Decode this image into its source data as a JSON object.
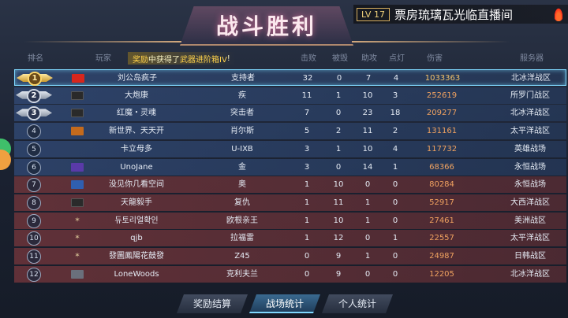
{
  "title": "战斗胜利",
  "broadcast": {
    "level": "LV 17",
    "text": "票房琉璃瓦光临直播间"
  },
  "notice": {
    "prefix": "奖励",
    "middle": "中获得了",
    "item": "武器进阶箱IV",
    "suffix": "!"
  },
  "headers": {
    "rank": "排名",
    "player": "玩家",
    "kills": "击败",
    "deaths": "被毁",
    "assists": "助攻",
    "points": "点灯",
    "damage": "伤害",
    "server": "服务器"
  },
  "rows": [
    {
      "rank": "1",
      "name": "刘公岛疯子",
      "ship": "支持者",
      "kills": "32",
      "deaths": "0",
      "assists": "7",
      "points": "4",
      "damage": "1033363",
      "server": "北冰洋战区",
      "team": "blue",
      "flag": "cn"
    },
    {
      "rank": "2",
      "name": "大炮康",
      "ship": "疾",
      "kills": "11",
      "deaths": "1",
      "assists": "10",
      "points": "3",
      "damage": "252619",
      "server": "所罗门战区",
      "team": "blue",
      "flag": "dark"
    },
    {
      "rank": "3",
      "name": "红魔・灵魂",
      "ship": "突击者",
      "kills": "7",
      "deaths": "0",
      "assists": "23",
      "points": "18",
      "damage": "209277",
      "server": "北冰洋战区",
      "team": "blue",
      "flag": "dark"
    },
    {
      "rank": "4",
      "name": "新世界、天天开",
      "ship": "肖尔斯",
      "kills": "5",
      "deaths": "2",
      "assists": "11",
      "points": "2",
      "damage": "131161",
      "server": "太平洋战区",
      "team": "blue",
      "flag": "orange"
    },
    {
      "rank": "5",
      "name": "卡立母多",
      "ship": "U-IXB",
      "kills": "3",
      "deaths": "1",
      "assists": "10",
      "points": "4",
      "damage": "117732",
      "server": "英雄战场",
      "team": "blue",
      "flag": "none"
    },
    {
      "rank": "6",
      "name": "UnoJane",
      "ship": "金",
      "kills": "3",
      "deaths": "0",
      "assists": "14",
      "points": "1",
      "damage": "68366",
      "server": "永恒战场",
      "team": "blue",
      "flag": "purple"
    },
    {
      "rank": "7",
      "name": "没见你几看空间",
      "ship": "奥",
      "kills": "1",
      "deaths": "10",
      "assists": "0",
      "points": "0",
      "damage": "80284",
      "server": "永恒战场",
      "team": "red",
      "flag": "blue"
    },
    {
      "rank": "8",
      "name": "天龍毅手",
      "ship": "复仇",
      "kills": "1",
      "deaths": "11",
      "assists": "1",
      "points": "0",
      "damage": "52917",
      "server": "大西洋战区",
      "team": "red",
      "flag": "dark"
    },
    {
      "rank": "9",
      "name": "듀토리얼확인",
      "ship": "欧根亲王",
      "kills": "1",
      "deaths": "10",
      "assists": "1",
      "points": "0",
      "damage": "27461",
      "server": "美洲战区",
      "team": "red",
      "flag": "star"
    },
    {
      "rank": "10",
      "name": "qjb",
      "ship": "拉福雷",
      "kills": "1",
      "deaths": "12",
      "assists": "0",
      "points": "1",
      "damage": "22557",
      "server": "太平洋战区",
      "team": "red",
      "flag": "star"
    },
    {
      "rank": "11",
      "name": "發圖鳳陽花鼓發",
      "ship": "Z45",
      "kills": "0",
      "deaths": "9",
      "assists": "1",
      "points": "0",
      "damage": "24987",
      "server": "日韩战区",
      "team": "red",
      "flag": "star"
    },
    {
      "rank": "12",
      "name": "LoneWoods",
      "ship": "克利夫兰",
      "kills": "0",
      "deaths": "9",
      "assists": "0",
      "points": "0",
      "damage": "12205",
      "server": "北冰洋战区",
      "team": "red",
      "flag": "grey"
    }
  ],
  "tabs": [
    "奖励结算",
    "战场统计",
    "个人统计"
  ],
  "active_tab": "战场统计",
  "colors": {
    "blue_team": "#324b78",
    "red_team": "#78373c",
    "highlight": "#7fd8ff",
    "gold": "#ffd24a"
  }
}
